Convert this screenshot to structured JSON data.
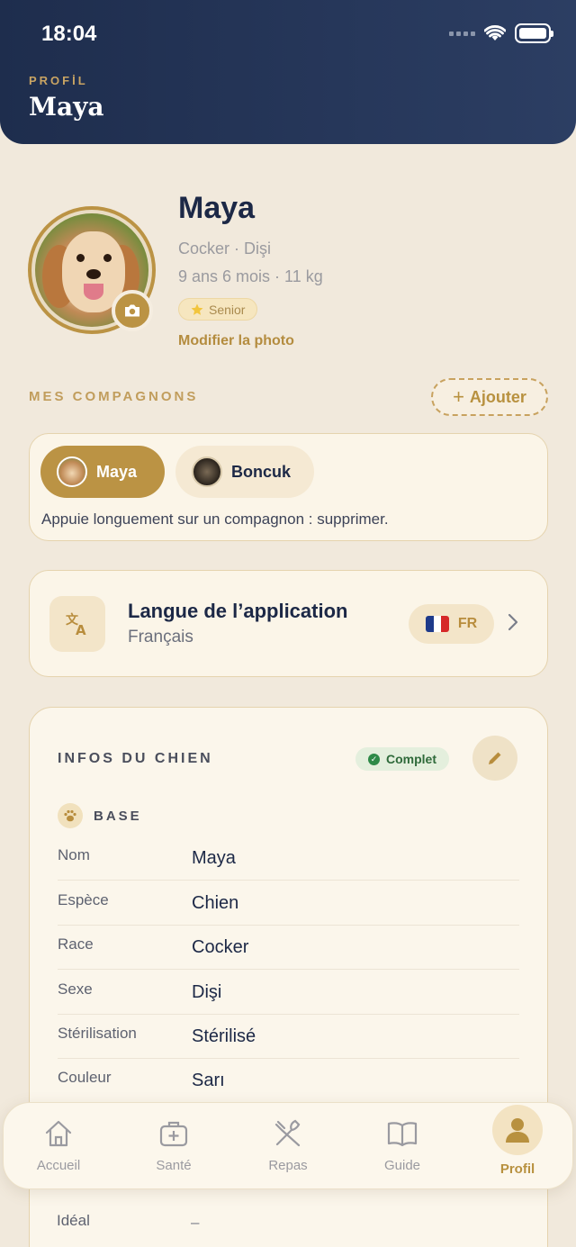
{
  "status_bar": {
    "time": "18:04"
  },
  "header": {
    "eyebrow": "PROFİL",
    "title": "Maya"
  },
  "profile": {
    "name": "Maya",
    "breed_sex": "Cocker · Dişi",
    "age_weight": "9 ans 6 mois · 11 kg",
    "badge": "Senior",
    "badge_icon": "star-icon",
    "modify_photo": "Modifier la photo"
  },
  "companions": {
    "label": "MES COMPAGNONS",
    "add_label": "Ajouter",
    "items": [
      {
        "name": "Maya",
        "active": true
      },
      {
        "name": "Boncuk",
        "active": false
      }
    ],
    "hint": "Appuie longuement sur un compagnon : supprimer."
  },
  "language": {
    "title": "Langue de l’application",
    "current": "Français",
    "code": "FR",
    "flag_colors": [
      "#1e3a8a",
      "#ffffff",
      "#d62828"
    ]
  },
  "dog_info": {
    "title": "INFOS DU CHIEN",
    "status": "Complet",
    "section": "BASE",
    "rows": [
      {
        "label": "Nom",
        "value": "Maya"
      },
      {
        "label": "Espèce",
        "value": "Chien"
      },
      {
        "label": "Race",
        "value": "Cocker"
      },
      {
        "label": "Sexe",
        "value": "Dişi"
      },
      {
        "label": "Stérilisation",
        "value": "Stérilisé"
      },
      {
        "label": "Couleur",
        "value": "Sarı"
      }
    ],
    "partial_row": {
      "label": "Idéal",
      "value": "–"
    }
  },
  "tabbar": {
    "items": [
      {
        "label": "Accueil",
        "icon": "home-icon"
      },
      {
        "label": "Santé",
        "icon": "medical-kit-icon"
      },
      {
        "label": "Repas",
        "icon": "utensils-icon"
      },
      {
        "label": "Guide",
        "icon": "book-icon"
      },
      {
        "label": "Profil",
        "icon": "user-icon",
        "active": true
      }
    ]
  },
  "colors": {
    "header_bg": "#1e2d4d",
    "accent_gold": "#bb9344",
    "background": "#f1e9dc",
    "success": "#2e8a48"
  }
}
